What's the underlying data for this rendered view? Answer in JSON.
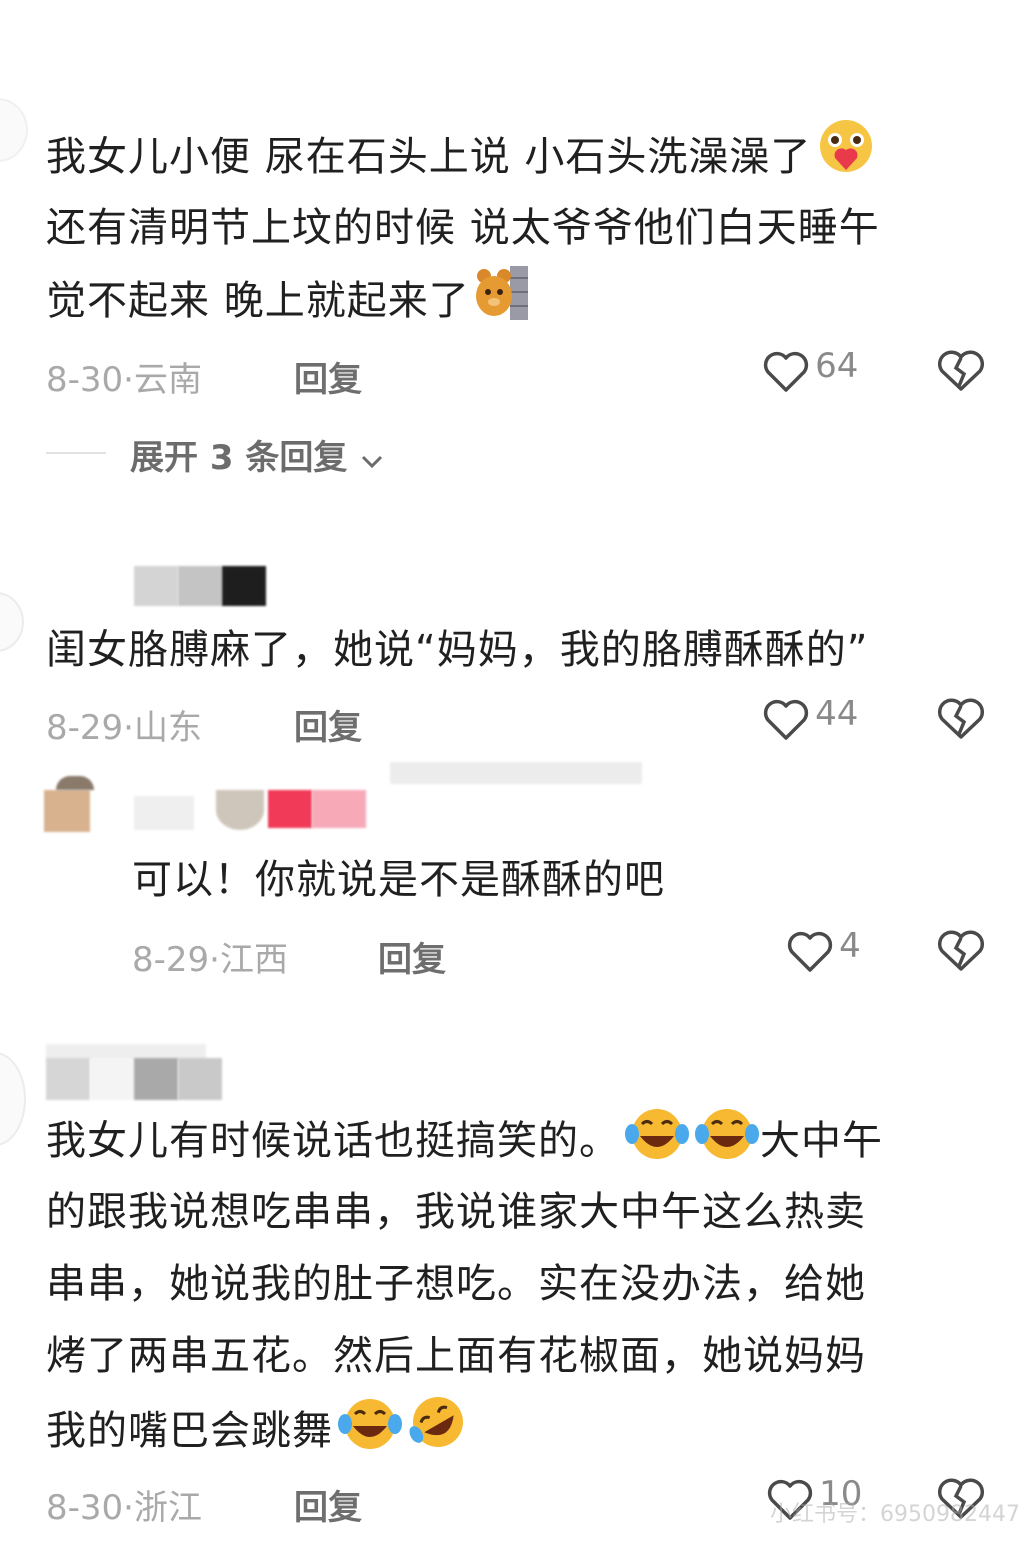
{
  "comments": [
    {
      "text_lines": [
        "我女儿小便 尿在石头上说 小石头洗澡澡了",
        "还有清明节上坟的时候 说太爷爷他们白天睡午",
        "觉不起来 晚上就起来了"
      ],
      "date": "8-30",
      "location": "云南",
      "reply_label": "回复",
      "like_count": "64",
      "expand_replies": "展开 3 条回复"
    },
    {
      "text_lines": [
        "闺女胳膊麻了，她说“妈妈，我的胳膊酥酥的”"
      ],
      "date": "8-29",
      "location": "山东",
      "reply_label": "回复",
      "like_count": "44"
    },
    {
      "text_lines": [
        "可以！你就说是不是酥酥的吧"
      ],
      "date": "8-29",
      "location": "江西",
      "reply_label": "回复",
      "like_count": "4"
    },
    {
      "text_lines": [
        "我女儿有时候说话也挺搞笑的。",
        "大中午",
        "的跟我说想吃串串，我说谁家大中午这么热卖",
        "串串，她说我的肚子想吃。实在没办法，给她",
        "烤了两串五花。然后上面有花椒面，她说妈妈",
        "我的嘴巴会跳舞"
      ],
      "date": "8-30",
      "location": "浙江",
      "reply_label": "回复",
      "like_count": "10"
    }
  ],
  "separator": "·",
  "watermark": "小红书号：6950982447",
  "icons": {
    "like": "heart-outline-icon",
    "dislike": "broken-heart-icon",
    "expand": "chevron-down-icon"
  },
  "colors": {
    "text": "#202020",
    "meta": "#a9a9a9",
    "reply": "#6e6e6e"
  }
}
